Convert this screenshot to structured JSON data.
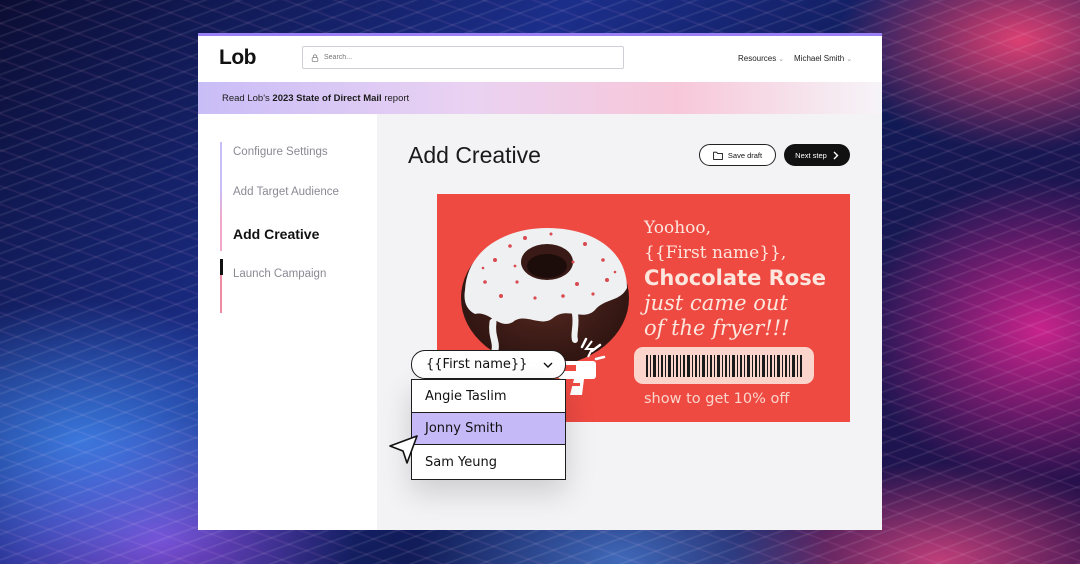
{
  "topbar": {
    "logo": "Lob",
    "search_placeholder": "Search...",
    "resources_label": "Resources",
    "user_name": "Michael Smith"
  },
  "banner": {
    "prefix": "Read Lob's ",
    "bold": "2023 State of Direct Mail",
    "suffix": " report"
  },
  "sidebar": {
    "steps": [
      {
        "label": "Configure Settings",
        "active": false
      },
      {
        "label": "Add Target Audience",
        "active": false
      },
      {
        "label": "Add Creative",
        "active": true
      },
      {
        "label": "Launch Campaign",
        "active": false
      }
    ]
  },
  "main": {
    "title": "Add Creative",
    "save_draft_label": "Save draft",
    "next_step_label": "Next step"
  },
  "creative": {
    "line1": "Yoohoo,",
    "line2": "{{First name}},",
    "line3": "Chocolate Rose",
    "line4": "just came out",
    "line5": "of the fryer!!!",
    "offer": "show to get 10% off",
    "background_color": "#ee4a42"
  },
  "dropdown": {
    "selected_value": "{{First name}}",
    "options": [
      "Angie Taslim",
      "Jonny Smith",
      "Sam Yeung"
    ],
    "highlighted_option": "Jonny Smith"
  },
  "colors": {
    "accent": "#9b7ff5",
    "highlight": "#c5baf7",
    "creative_red": "#ee4a42"
  }
}
